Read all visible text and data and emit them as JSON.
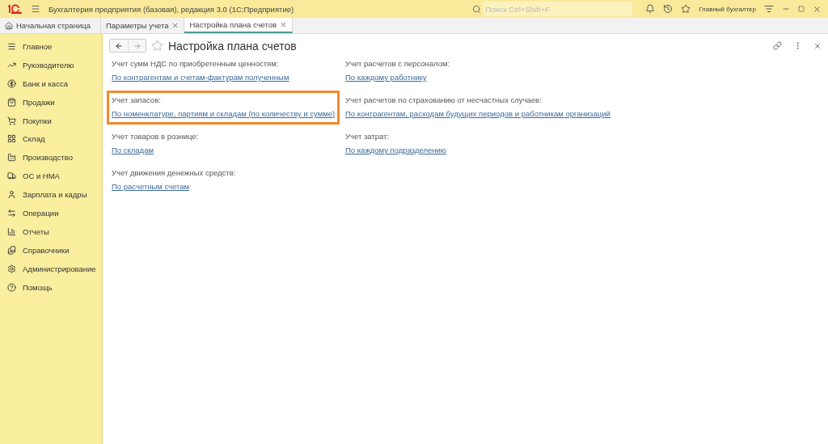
{
  "window": {
    "title": "Бухгалтерия предприятия (базовая), редакция 3.0  (1С:Предприятие)",
    "search": {
      "placeholder": "Поиск Ctrl+Shift+F"
    },
    "user": "Главный бухгалтер"
  },
  "tabs": [
    {
      "label": "Начальная страница",
      "selected": false,
      "closable": false
    },
    {
      "label": "Параметры учета",
      "selected": false,
      "closable": true
    },
    {
      "label": "Настройка плана счетов",
      "selected": true,
      "closable": true
    }
  ],
  "sidebar": {
    "items": [
      {
        "label": "Главное"
      },
      {
        "label": "Руководителю"
      },
      {
        "label": "Банк и касса"
      },
      {
        "label": "Продажи"
      },
      {
        "label": "Покупки"
      },
      {
        "label": "Склад"
      },
      {
        "label": "Производство"
      },
      {
        "label": "ОС и НМА"
      },
      {
        "label": "Зарплата и кадры"
      },
      {
        "label": "Операции"
      },
      {
        "label": "Отчеты"
      },
      {
        "label": "Справочники"
      },
      {
        "label": "Администрирование"
      },
      {
        "label": "Помощь"
      }
    ]
  },
  "form": {
    "title": "Настройка плана счетов",
    "columns": [
      [
        {
          "label": "Учет сумм НДС по приобретенным ценностям:",
          "link": "По контрагентам и счетам-фактурам полученным",
          "highlighted": false
        },
        {
          "label": "Учет запасов:",
          "link": "По номенклатуре, партиям и складам (по количеству и сумме)",
          "highlighted": true
        },
        {
          "label": "Учет товаров в рознице:",
          "link": "По складам",
          "highlighted": false
        },
        {
          "label": "Учет движения денежных средств:",
          "link": "По расчетным счетам",
          "highlighted": false
        }
      ],
      [
        {
          "label": "Учет расчетов с персоналом:",
          "link": "По каждому работнику",
          "highlighted": false
        },
        {
          "label": "Учет расчетов по страхованию от несчастных случаев:",
          "link": "По контрагентам, расходам будущих периодов и работникам организаций",
          "highlighted": false
        },
        {
          "label": "Учет затрат:",
          "link": "По каждому подразделению",
          "highlighted": false
        }
      ]
    ]
  }
}
